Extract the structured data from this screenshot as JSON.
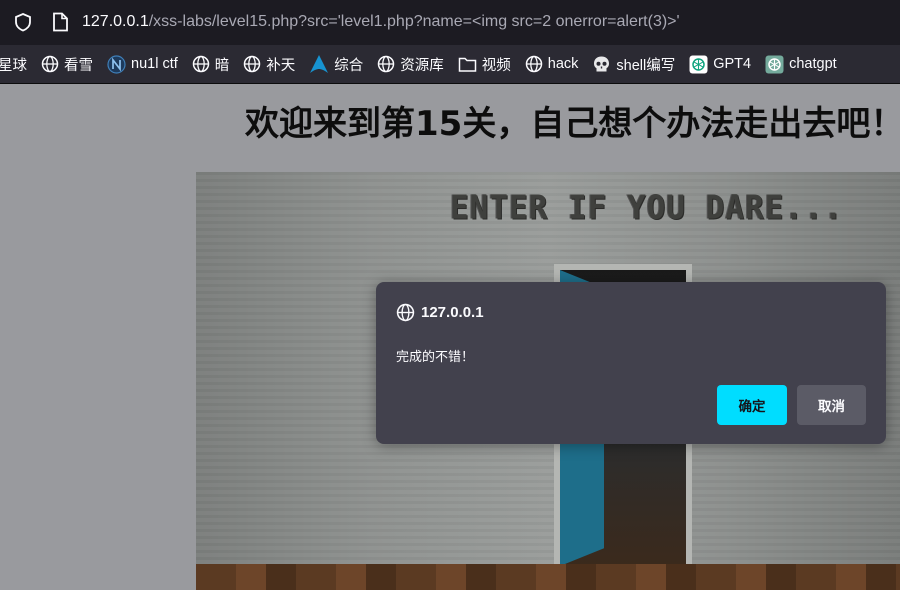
{
  "browser": {
    "url_host": "127.0.0.1",
    "url_path": "/xss-labs/level15.php?src='level1.php?name=<img src=2 onerror=alert(3)>'",
    "bookmarks": [
      {
        "label": "星球",
        "icon": "none"
      },
      {
        "label": "看雪",
        "icon": "globe-icon"
      },
      {
        "label": "nu1l ctf",
        "icon": "n-logo-icon"
      },
      {
        "label": "暗",
        "icon": "globe-icon"
      },
      {
        "label": "补天",
        "icon": "globe-icon"
      },
      {
        "label": "综合",
        "icon": "arch-logo-icon"
      },
      {
        "label": "资源库",
        "icon": "globe-icon"
      },
      {
        "label": "视频",
        "icon": "folder-icon"
      },
      {
        "label": "hack",
        "icon": "globe-icon"
      },
      {
        "label": "shell编写",
        "icon": "skull-icon"
      },
      {
        "label": "GPT4",
        "icon": "openai-icon"
      },
      {
        "label": "chatgpt",
        "icon": "openai-icon"
      }
    ]
  },
  "page": {
    "title": "欢迎来到第15关，自己想个办法走出去吧！",
    "artwork_text": "ENTER IF YOU DARE..."
  },
  "dialog": {
    "origin": "127.0.0.1",
    "message": "完成的不错！",
    "ok_label": "确定",
    "cancel_label": "取消"
  },
  "colors": {
    "toolbar_bg": "#1c1b22",
    "bookmarks_bg": "#2b2a33",
    "dialog_bg": "#42414d",
    "ok_button": "#00ddff",
    "cancel_button": "#5b5b66",
    "door": "#1e6e8a"
  }
}
